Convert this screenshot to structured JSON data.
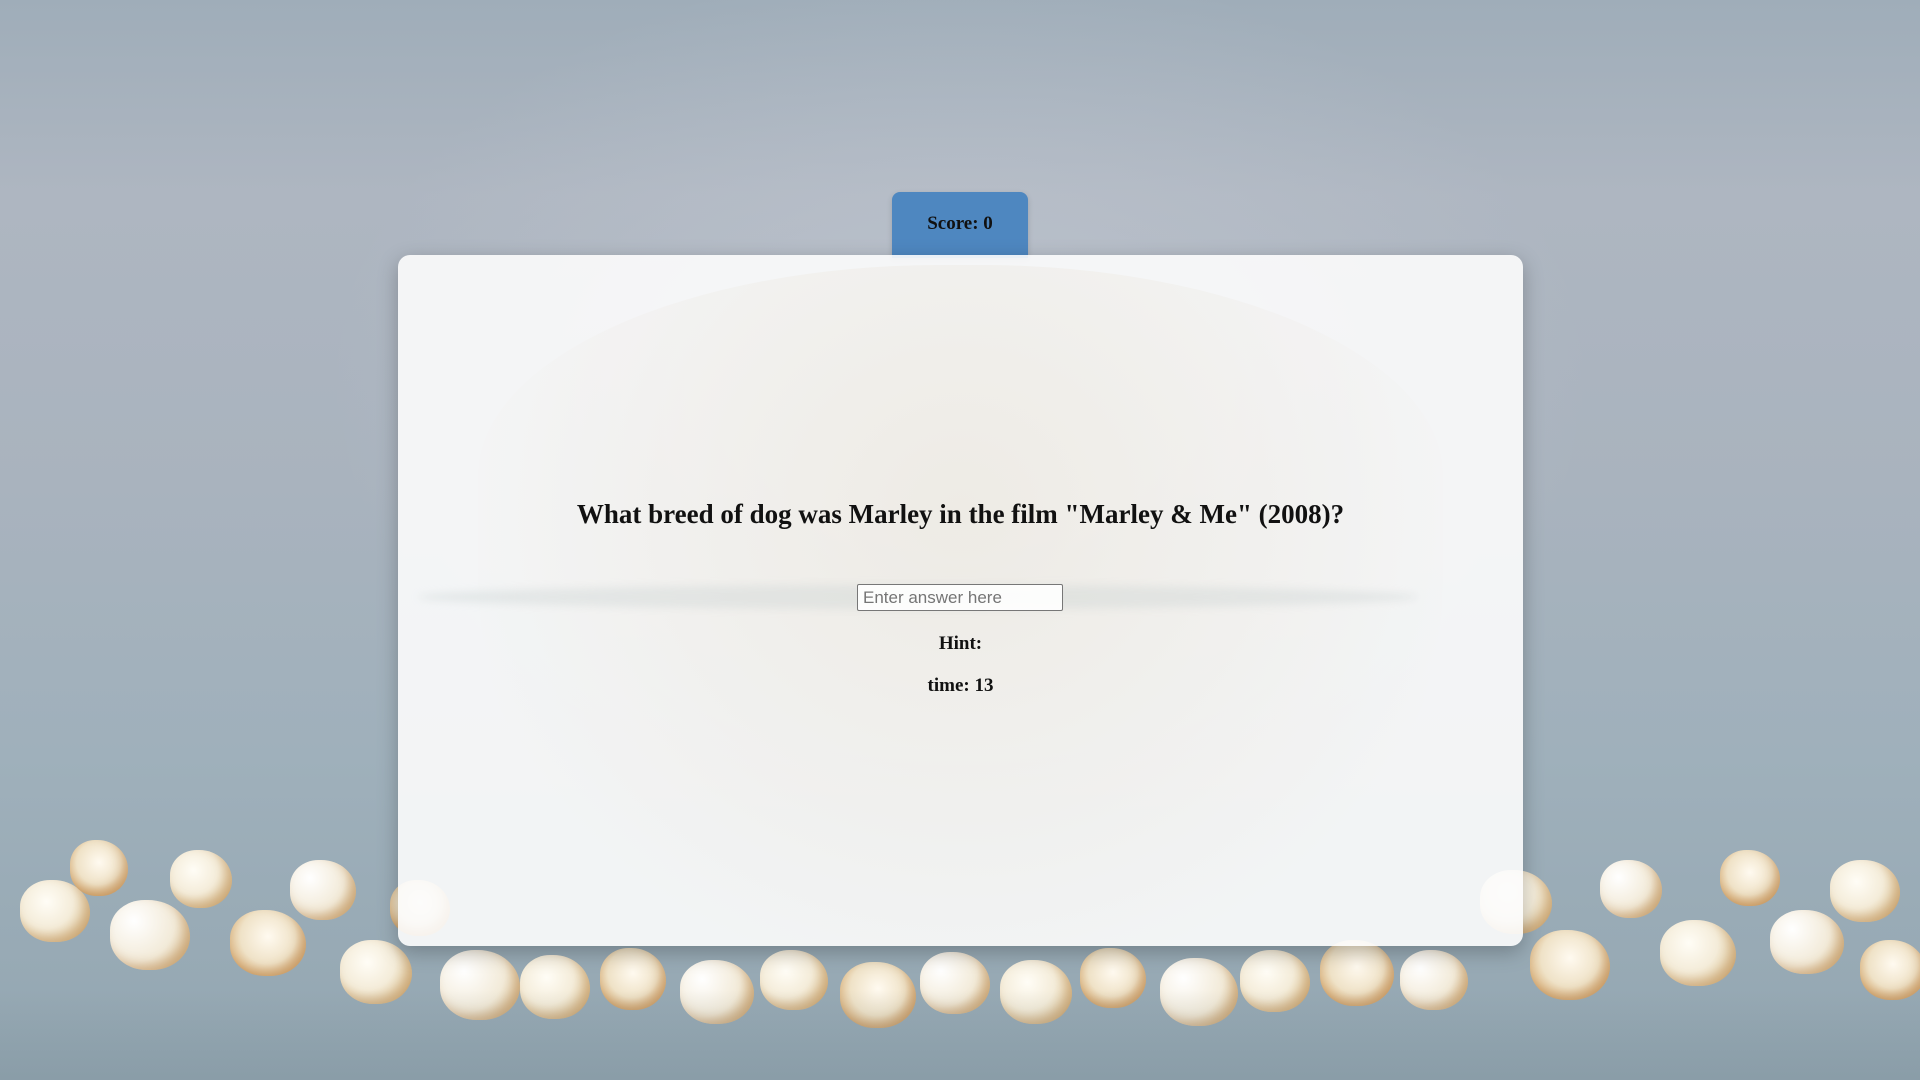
{
  "score": {
    "label": "Score:",
    "value": "0"
  },
  "question": {
    "text": "What breed of dog was Marley in the film \"Marley & Me\" (2008)?"
  },
  "answer": {
    "value": "",
    "placeholder": "Enter answer here"
  },
  "hint": {
    "label": "Hint:",
    "text": ""
  },
  "timer": {
    "label": "time:",
    "value": "13"
  },
  "colors": {
    "score_tab": "#4e87c0",
    "card": "#fcfcfc",
    "background": "#a9b3be"
  }
}
